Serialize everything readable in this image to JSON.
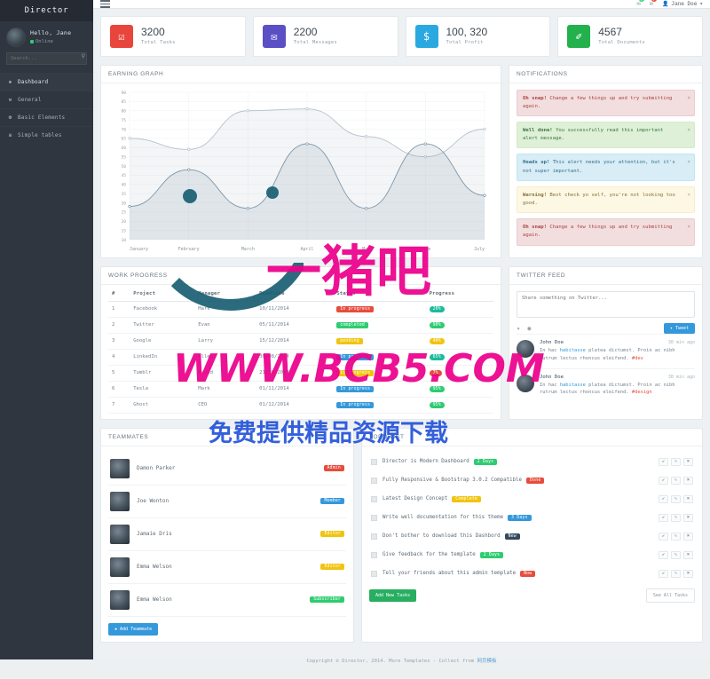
{
  "brand": "Director",
  "sidebar": {
    "user": {
      "hello": "Hello, Jane",
      "status": "Online"
    },
    "search": {
      "placeholder": "Search...",
      "value": "",
      "icon": "search-icon"
    },
    "items": [
      {
        "label": "Dashboard",
        "icon": "dashboard-icon",
        "glyph": "❖",
        "active": true
      },
      {
        "label": "General",
        "icon": "wrench-icon",
        "glyph": "⚒",
        "active": false
      },
      {
        "label": "Basic Elements",
        "icon": "gear-icon",
        "glyph": "⚙",
        "active": false
      },
      {
        "label": "Simple tables",
        "icon": "table-icon",
        "glyph": "≡",
        "active": false
      }
    ]
  },
  "topbar": {
    "menu_toggle": "hamburger-icon",
    "mail": {
      "icon": "mail-icon",
      "count": "3",
      "color": "#2ecc71"
    },
    "bell": {
      "icon": "bell-icon",
      "count": "7",
      "color": "#e74c3c"
    },
    "user": {
      "name": "Jane Doe",
      "caret": "▾",
      "icon": "user-icon"
    }
  },
  "stats": [
    {
      "value": "3200",
      "label": "Total Tasks",
      "icon": "check-square-icon",
      "glyph": "☑",
      "color": "#e8453c"
    },
    {
      "value": "2200",
      "label": "Total Messages",
      "icon": "envelope-icon",
      "glyph": "✉",
      "color": "#5b4fc6"
    },
    {
      "value": "100, 320",
      "label": "Total Profit",
      "icon": "dollar-icon",
      "glyph": "$",
      "color": "#2aa9e0"
    },
    {
      "value": "4567",
      "label": "Total Documents",
      "icon": "paperclip-icon",
      "glyph": "✐",
      "color": "#22b14c"
    }
  ],
  "earning_graph": {
    "title": "EARNING GRAPH"
  },
  "chart_data": {
    "type": "area",
    "title": "EARNING GRAPH",
    "xlabel": "",
    "ylabel": "",
    "ylim": [
      10,
      90
    ],
    "grid": true,
    "legend": "none",
    "categories": [
      "January",
      "February",
      "March",
      "April",
      "May",
      "June",
      "July"
    ],
    "yticks": [
      10,
      15,
      20,
      25,
      30,
      35,
      40,
      45,
      50,
      55,
      60,
      65,
      70,
      75,
      80,
      85,
      90
    ],
    "series": [
      {
        "name": "Earnings",
        "color": "#7f98a8",
        "values": [
          28,
          48,
          27,
          62,
          27,
          62,
          34
        ]
      },
      {
        "name": "Target",
        "color": "#b7c3cc",
        "values": [
          65,
          59,
          80,
          81,
          66,
          55,
          70
        ]
      }
    ]
  },
  "notifications": {
    "title": "NOTIFICATIONS",
    "items": [
      {
        "type": "danger",
        "strong": "Oh snap!",
        "text": "Change a few things up and try submitting again."
      },
      {
        "type": "success",
        "strong": "Well done!",
        "text": "You successfully read this important alert message."
      },
      {
        "type": "info",
        "strong": "Heads up!",
        "text": "This alert needs your attention, but it's not super important."
      },
      {
        "type": "warning",
        "strong": "Warning!",
        "text": "Best check yo self, you're not looking too good."
      },
      {
        "type": "danger",
        "strong": "Oh snap!",
        "text": "Change a few things up and try submitting again."
      }
    ],
    "close_icon": "close-icon"
  },
  "work_progress": {
    "title": "WORK PROGRESS",
    "columns": [
      "#",
      "Project",
      "Manager",
      "Deadline",
      "Status",
      "Progress"
    ],
    "rows": [
      {
        "n": "1",
        "project": "Facebook",
        "manager": "Mark",
        "deadline": "10/11/2014",
        "status": "In progress",
        "status_color": "l-red",
        "progress": "20%",
        "progress_color": "l-cyan"
      },
      {
        "n": "2",
        "project": "Twitter",
        "manager": "Evan",
        "deadline": "05/11/2014",
        "status": "completed",
        "status_color": "l-green",
        "progress": "90%",
        "progress_color": "l-green"
      },
      {
        "n": "3",
        "project": "Google",
        "manager": "Larry",
        "deadline": "15/12/2014",
        "status": "pending",
        "status_color": "l-yellow",
        "progress": "40%",
        "progress_color": "l-yellow"
      },
      {
        "n": "4",
        "project": "LinkedIn",
        "manager": "Allen",
        "deadline": "30/08/2014",
        "status": "In progress",
        "status_color": "l-blue",
        "progress": "65%",
        "progress_color": "l-cyan"
      },
      {
        "n": "5",
        "project": "Tumblr",
        "manager": "David",
        "deadline": "21/10/2014",
        "status": "in progress",
        "status_color": "l-yellow",
        "progress": "7%",
        "progress_color": "l-red"
      },
      {
        "n": "6",
        "project": "Tesla",
        "manager": "Mark",
        "deadline": "01/11/2014",
        "status": "In progress",
        "status_color": "l-blue",
        "progress": "95%",
        "progress_color": "l-green"
      },
      {
        "n": "7",
        "project": "Ghost",
        "manager": "CEO",
        "deadline": "01/12/2014",
        "status": "In progress",
        "status_color": "l-blue",
        "progress": "95%",
        "progress_color": "l-green"
      }
    ]
  },
  "twitter_feed": {
    "title": "TWITTER FEED",
    "composer": {
      "placeholder": "Share something on Twitter...",
      "value": ""
    },
    "tools": [
      {
        "icon": "twitter-icon",
        "glyph": "✦"
      },
      {
        "icon": "camera-icon",
        "glyph": "◉"
      }
    ],
    "tweet_button": {
      "label": "Tweet",
      "icon": "twitter-icon",
      "glyph": "✦"
    },
    "tweets": [
      {
        "name": "John Doe",
        "time": "30 min ago",
        "text_before": "In hac ",
        "link": "habitasse",
        "text_mid": " platea dictumst. Proin ac nibh rutrum lectus rhoncus eleifend. ",
        "tag": "#dev"
      },
      {
        "name": "John Doe",
        "time": "30 min ago",
        "text_before": "In hac ",
        "link": "habitasse",
        "text_mid": " platea dictumst. Proin ac nibh rutrum lectus rhoncus eleifend. ",
        "tag": "#design"
      }
    ]
  },
  "teammates": {
    "title": "TEAMMATES",
    "members": [
      {
        "name": "Damon Parker",
        "role": "Admin",
        "role_color": "l-red"
      },
      {
        "name": "Joe Wonton",
        "role": "Member",
        "role_color": "l-blue"
      },
      {
        "name": "Jamaie Dris",
        "role": "Editor",
        "role_color": "l-yellow"
      },
      {
        "name": "Emma Welson",
        "role": "Editor",
        "role_color": "l-yellow"
      },
      {
        "name": "Emma Welson",
        "role": "Subscriber",
        "role_color": "l-green"
      }
    ],
    "add_button": {
      "label": "Add Teammate",
      "glyph": "✚"
    }
  },
  "todo_list": {
    "title": "TODO LIST",
    "items": [
      {
        "text": "Director is Modern Dashboard",
        "badge": "2 Days",
        "badge_color": "l-green"
      },
      {
        "text": "Fully Responsive & Bootstrap 3.0.2 Compatible",
        "badge": "Done",
        "badge_color": "l-red"
      },
      {
        "text": "Latest Design Concept",
        "badge": "Complete",
        "badge_color": "l-yellow"
      },
      {
        "text": "Write well documentation for this theme",
        "badge": "3 Days",
        "badge_color": "l-blue"
      },
      {
        "text": "Don't bother to download this Dashbord",
        "badge": "New",
        "badge_color": "l-dark"
      },
      {
        "text": "Give feedback for the template",
        "badge": "2 Days",
        "badge_color": "l-green"
      },
      {
        "text": "Tell your friends about this admin template",
        "badge": "Now",
        "badge_color": "l-red"
      }
    ],
    "actions": [
      {
        "icon": "check-icon",
        "glyph": "✔"
      },
      {
        "icon": "pencil-icon",
        "glyph": "✎"
      },
      {
        "icon": "close-icon",
        "glyph": "✖"
      }
    ],
    "add_button": "Add New Tasks",
    "see_all_button": "See All Tasks"
  },
  "footer": {
    "text": "Copyright © Director, 2014. More Templates - Collect from ",
    "link": "网页模板"
  },
  "watermarks": {
    "pink_cn": "一猪吧",
    "pink_url": "WWW.BCB5.COM",
    "blue_cn": "免费提供精品资源下载"
  }
}
